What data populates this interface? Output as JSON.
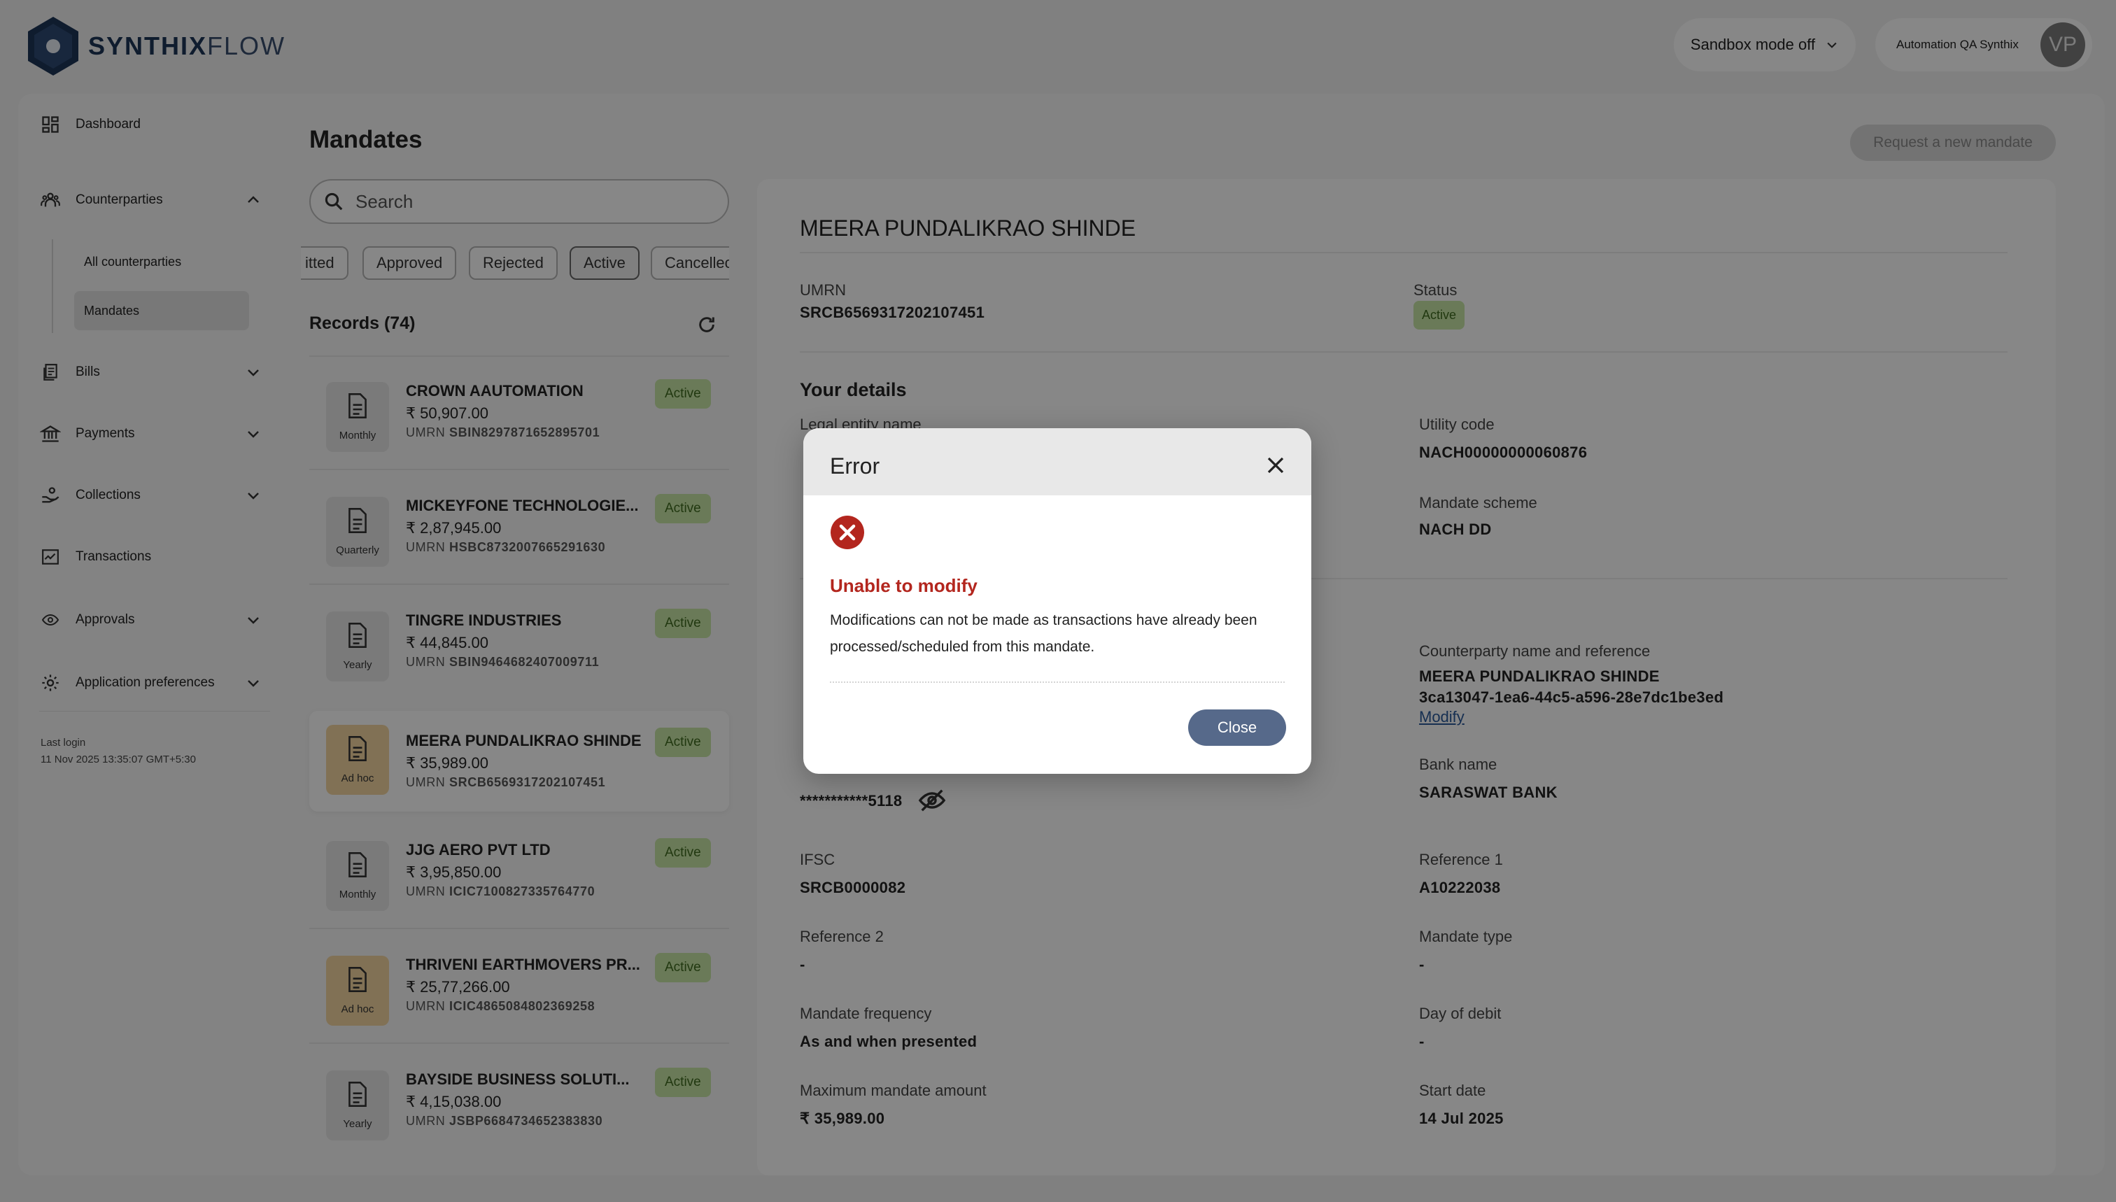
{
  "brand": {
    "name_bold": "SYNTHIX",
    "name_thin": "FLOW"
  },
  "header": {
    "sandbox_label": "Sandbox mode off",
    "account_name": "Automation QA Synthix",
    "avatar_initials": "VP"
  },
  "sidebar": {
    "items": [
      {
        "label": "Dashboard"
      },
      {
        "label": "Counterparties"
      },
      {
        "label": "Bills"
      },
      {
        "label": "Payments"
      },
      {
        "label": "Collections"
      },
      {
        "label": "Transactions"
      },
      {
        "label": "Approvals"
      },
      {
        "label": "Application preferences"
      }
    ],
    "subitems": [
      {
        "label": "All counterparties"
      },
      {
        "label": "Mandates"
      }
    ],
    "last_login_label": "Last login",
    "last_login_value": "11 Nov 2025 13:35:07 GMT+5:30"
  },
  "main": {
    "title": "Mandates",
    "request_button": "Request a new mandate",
    "search_placeholder": "Search",
    "filters": [
      "itted",
      "Approved",
      "Rejected",
      "Active",
      "Cancellec"
    ],
    "active_filter": "Active",
    "records_label": "Records (74)"
  },
  "mandates": [
    {
      "name": "CROWN AAUTOMATION",
      "amount": "₹ 50,907.00",
      "umrn_label": "UMRN",
      "umrn": "SBIN8297871652895701",
      "frequency": "Monthly",
      "status": "Active"
    },
    {
      "name": "MICKEYFONE TECHNOLOGIE...",
      "amount": "₹ 2,87,945.00",
      "umrn_label": "UMRN",
      "umrn": "HSBC8732007665291630",
      "frequency": "Quarterly",
      "status": "Active"
    },
    {
      "name": "TINGRE INDUSTRIES",
      "amount": "₹ 44,845.00",
      "umrn_label": "UMRN",
      "umrn": "SBIN9464682407009711",
      "frequency": "Yearly",
      "status": "Active"
    },
    {
      "name": "MEERA PUNDALIKRAO SHINDE",
      "amount": "₹ 35,989.00",
      "umrn_label": "UMRN",
      "umrn": "SRCB6569317202107451",
      "frequency": "Ad hoc",
      "status": "Active"
    },
    {
      "name": "JJG AERO PVT LTD",
      "amount": "₹ 3,95,850.00",
      "umrn_label": "UMRN",
      "umrn": "ICIC7100827335764770",
      "frequency": "Monthly",
      "status": "Active"
    },
    {
      "name": "THRIVENI EARTHMOVERS PR...",
      "amount": "₹ 25,77,266.00",
      "umrn_label": "UMRN",
      "umrn": "ICIC4865084802369258",
      "frequency": "Ad hoc",
      "status": "Active"
    },
    {
      "name": "BAYSIDE BUSINESS SOLUTI...",
      "amount": "₹ 4,15,038.00",
      "umrn_label": "UMRN",
      "umrn": "JSBP6684734652383830",
      "frequency": "Yearly",
      "status": "Active"
    }
  ],
  "detail": {
    "name": "MEERA PUNDALIKRAO SHINDE",
    "umrn_label": "UMRN",
    "umrn": "SRCB6569317202107451",
    "status_label": "Status",
    "status": "Active",
    "your_details_heading": "Your details",
    "legal_entity_label": "Legal entity name",
    "utility_code_label": "Utility code",
    "utility_code": "NACH00000000060876",
    "mandate_scheme_label": "Mandate scheme",
    "mandate_scheme": "NACH DD",
    "counterparty_label": "Counterparty name and reference",
    "counterparty_name": "MEERA PUNDALIKRAO SHINDE",
    "counterparty_ref": "3ca13047-1ea6-44c5-a596-28e7dc1be3ed",
    "modify_link": "Modify",
    "account_number": "***********5118",
    "bank_name_label": "Bank name",
    "bank_name": "SARASWAT BANK",
    "ifsc_label": "IFSC",
    "ifsc": "SRCB0000082",
    "reference1_label": "Reference 1",
    "reference1": "A10222038",
    "reference2_label": "Reference 2",
    "reference2": "-",
    "mandate_type_label": "Mandate type",
    "mandate_type": "-",
    "frequency_label": "Mandate frequency",
    "frequency": "As and when presented",
    "day_of_debit_label": "Day of debit",
    "day_of_debit": "-",
    "max_amount_label": "Maximum mandate amount",
    "max_amount": "₹ 35,989.00",
    "start_date_label": "Start date",
    "start_date": "14 Jul 2025"
  },
  "modal": {
    "title": "Error",
    "error_title": "Unable to modify",
    "message": "Modifications can not be made as transactions have already been processed/scheduled from this mandate.",
    "close_button": "Close"
  },
  "colors": {
    "active_badge_bg": "#c8e6a6",
    "active_badge_text": "#3f6b1f",
    "adhoc_tile": "#f3d6a0",
    "error_red": "#b3261e",
    "close_button": "#56698a",
    "link": "#2b5a9a"
  }
}
